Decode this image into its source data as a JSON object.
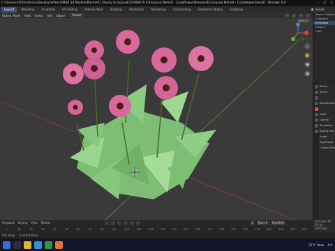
{
  "window": {
    "title": "C:\\Users\\rtrfr\\OneDrive\\Desktop\\#Ste-DMIDI 3d Models\\Plants\\01_Ready to Upload\\2C000070 Echinacea Moheit - Coneflower\\Blender\\Echinacea Moheit - Coneflower.blend] - Blender 4.0",
    "controls": [
      "–",
      "□",
      "✕"
    ]
  },
  "tabs": [
    "Layout",
    "Modeling",
    "Sculpting",
    "UV Editing",
    "Texture Paint",
    "Shading",
    "Animation",
    "Rendering",
    "Compositing",
    "Geometry Nodes",
    "Scripting"
  ],
  "active_tab": "Layout",
  "scene_label": "Scene",
  "viewport_header": {
    "mode": "Object Mode",
    "items": [
      "View",
      "Select",
      "Add",
      "Object"
    ],
    "orientation": "Global",
    "options": "Options"
  },
  "viewport_tools": [
    "magnify-icon",
    "hand-icon",
    "camera-icon",
    "grid-icon"
  ],
  "outliner": {
    "rows": [
      "Scene Collection",
      "Collection",
      "Echinacea",
      "Camera",
      "Light"
    ]
  },
  "properties": {
    "rows": [
      "Scene",
      "Scene",
      "",
      "Background",
      "",
      "Units",
      "Gravity",
      "Simulation",
      "Keying Sets",
      "Audio",
      "Rigid Body",
      "Custom Props"
    ]
  },
  "timeline": {
    "playback": "Playback",
    "keying": "Keying",
    "view": "View",
    "marker": "Marker",
    "current_frame": "1",
    "start": "Start 1",
    "end": "End 250",
    "ruler": [
      "0",
      "10",
      "20",
      "30",
      "40",
      "50",
      "60",
      "70",
      "80",
      "90",
      "100",
      "110",
      "120",
      "130",
      "140",
      "150",
      "160",
      "170",
      "180",
      "190",
      "200",
      "210",
      "220",
      "230",
      "240",
      "250"
    ]
  },
  "activate_windows": {
    "line1": "Activate W",
    "line2": "Go to Settings"
  },
  "status_bar": {
    "left": "Pan View",
    "mid": "Context Menu"
  },
  "tray": {
    "weather": "22°C Haze",
    "time": "4:0"
  },
  "colors": {
    "accent": "#3d4f7a",
    "petal": "#d9699c",
    "leaf": "#8fce86",
    "viewport_bg": "#3a3a3a"
  }
}
